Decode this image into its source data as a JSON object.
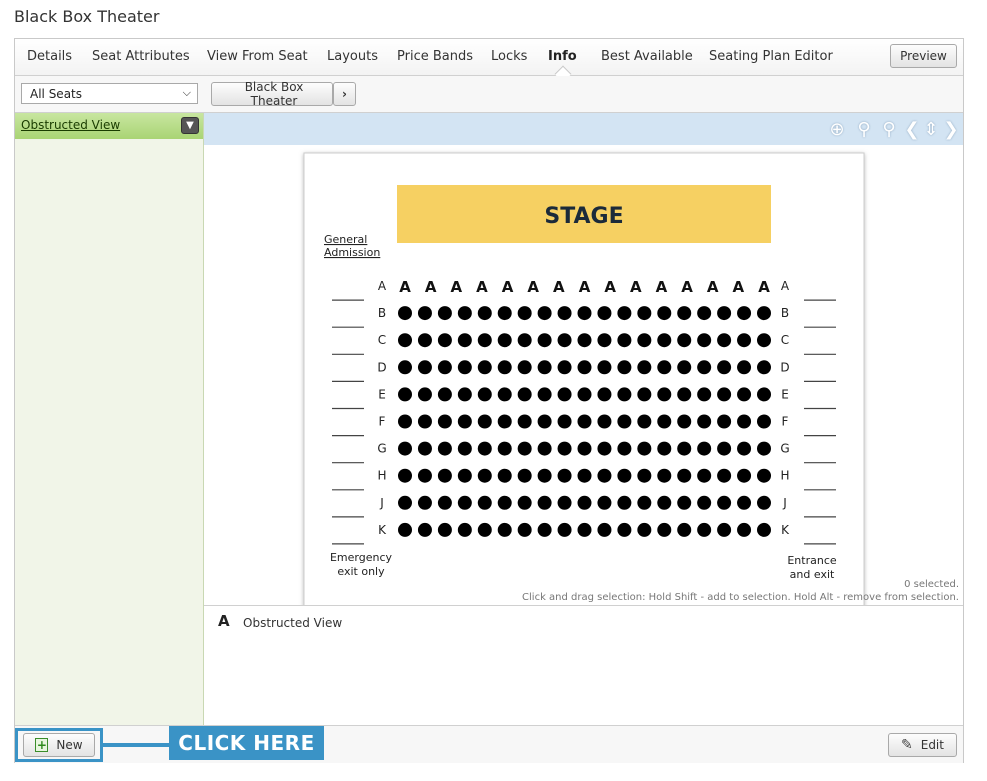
{
  "page": {
    "title": "Black Box Theater"
  },
  "tabs": [
    {
      "label": "Details",
      "name": "tab-details"
    },
    {
      "label": "Seat Attributes",
      "name": "tab-seat-attributes"
    },
    {
      "label": "View From Seat",
      "name": "tab-view-from-seat"
    },
    {
      "label": "Layouts",
      "name": "tab-layouts"
    },
    {
      "label": "Price Bands",
      "name": "tab-price-bands"
    },
    {
      "label": "Locks",
      "name": "tab-locks"
    },
    {
      "label": "Info",
      "name": "tab-info",
      "active": true
    },
    {
      "label": "Best Available",
      "name": "tab-best-available"
    },
    {
      "label": "Seating Plan Editor",
      "name": "tab-seating-plan-editor"
    }
  ],
  "header": {
    "preview_label": "Preview"
  },
  "filter": {
    "seat_select_value": "All Seats",
    "venue_label": "Black Box Theater",
    "venue_next_icon": "chevron-right-icon"
  },
  "sidebar": {
    "attribute": {
      "label": "Obstructed View",
      "dropdown_icon": "chevron-down-icon"
    }
  },
  "toolbar_icons": [
    "crosshair-icon",
    "zoom-in-icon",
    "zoom-out-icon",
    "pan-left-icon",
    "pan-up-down-icon",
    "pan-right-icon"
  ],
  "plan": {
    "stage_label": "STAGE",
    "general_admission_lines": [
      "General",
      "Admission"
    ],
    "rows": [
      "A",
      "B",
      "C",
      "D",
      "E",
      "F",
      "G",
      "H",
      "J",
      "K"
    ],
    "seats_per_row": 15,
    "row_b_to_k_seats": 19,
    "obstructed_symbol": "A",
    "emergency_exit_lines": [
      "Emergency",
      "exit only"
    ],
    "entrance_lines": [
      "Entrance",
      "and exit"
    ],
    "stage_color": "#f6d062"
  },
  "status": {
    "selected": "0 selected.",
    "hint": "Click and drag selection: Hold Shift - add to selection. Hold Alt - remove from selection."
  },
  "legend": {
    "symbol": "A",
    "label": "Obstructed View"
  },
  "bottom": {
    "new_label": "New",
    "edit_label": "Edit",
    "callout": "CLICK HERE"
  },
  "colors": {
    "accent": "#3a93c6",
    "sidebar_active": "#a9d474",
    "toolbar_bg": "#d3e4f3"
  }
}
